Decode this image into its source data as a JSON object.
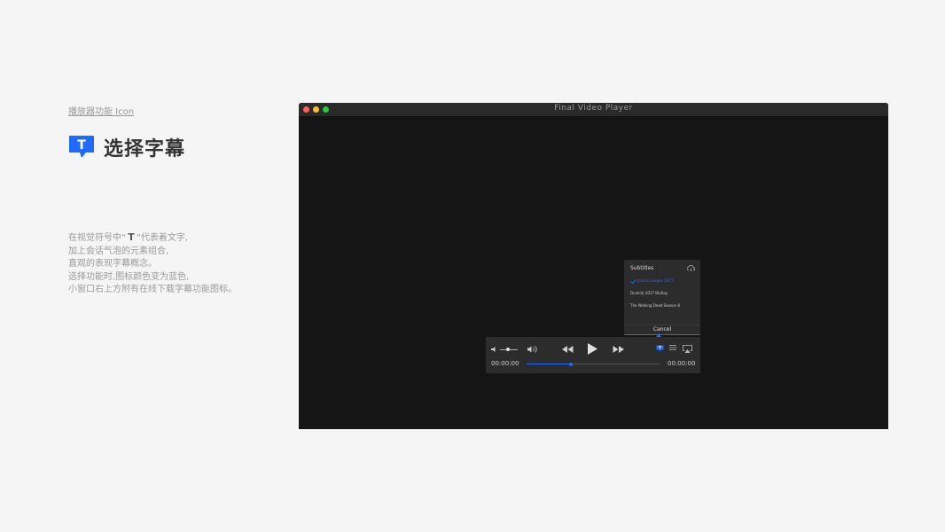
{
  "page": {
    "breadcrumb": "播放器功能 Icon",
    "title": "选择字幕",
    "title_icon_letter": "T",
    "desc": {
      "line1_before": "在视觉符号中“",
      "line1_mark": "T",
      "line1_after": "”代表着文字,",
      "line2": "加上会话气泡的元素组合,",
      "line3": "直观的表现字幕概念。",
      "line4": "选择功能时,图标颜色变为蓝色,",
      "line5": "小窗口右上方附有在线下载字幕功能图标。"
    }
  },
  "player": {
    "window_title": "Final Video Player",
    "subtitles": {
      "header": "Subtitles",
      "options": [
        "Justice League 2017",
        "Dunkirk 2017 BluRay",
        "The Walking Dead Season 8"
      ],
      "selected_index": 0,
      "cancel_label": "Cancel"
    },
    "controls": {
      "time_current": "00:00:00",
      "time_total": "00:00:00",
      "progress": 0.33,
      "volume": 0.4
    }
  },
  "colors": {
    "accent": "#1f6bff",
    "window_bg": "#151515",
    "panel_bg": "#2c2c2c",
    "page_bg": "#f5f5f5"
  },
  "icons": [
    "subtitle-bubble-icon",
    "cloud-download-icon",
    "check-icon",
    "volume-low-icon",
    "volume-high-icon",
    "rewind-icon",
    "play-icon",
    "fast-forward-icon",
    "subtitle-icon",
    "playlist-icon",
    "airplay-icon"
  ]
}
